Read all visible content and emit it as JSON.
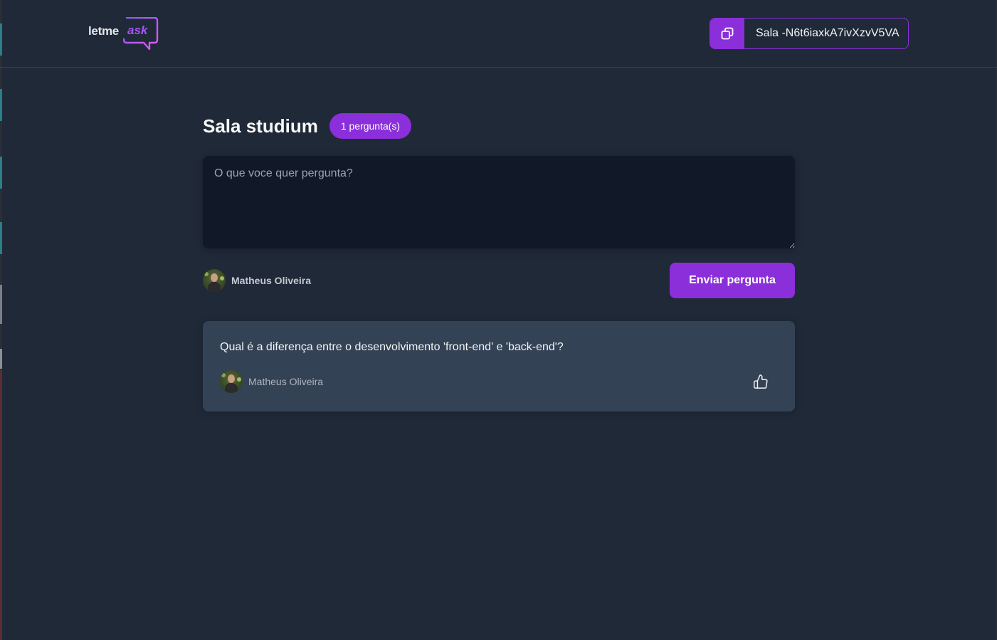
{
  "header": {
    "logo_text_left": "letme",
    "logo_text_right": "ask",
    "room_code_label": "Sala -N6t6iaxkA7ivXzvV5VA"
  },
  "room": {
    "title": "Sala studium",
    "question_count_badge": "1 pergunta(s)"
  },
  "form": {
    "placeholder": "O que voce quer pergunta?",
    "value": "",
    "user_name": "Matheus Oliveira",
    "submit_label": "Enviar pergunta"
  },
  "questions": [
    {
      "content": "Qual é a diferença entre o desenvolvimento 'front-end' e 'back-end'?",
      "author": "Matheus Oliveira"
    }
  ],
  "colors": {
    "background": "#1f2937",
    "accent": "#8b2fdb",
    "card": "#344255",
    "input": "#111827"
  },
  "icons": {
    "copy": "copy-icon",
    "like": "thumbs-up-icon",
    "logo": "speech-bubble-icon"
  }
}
